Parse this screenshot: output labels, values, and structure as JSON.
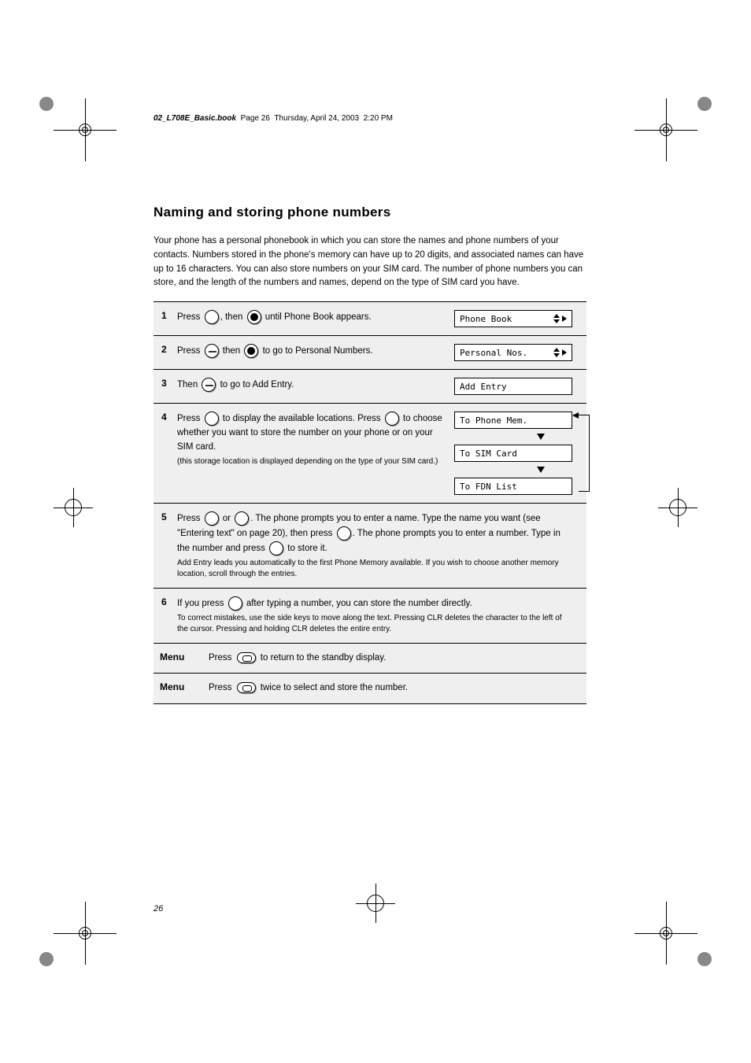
{
  "running_header": {
    "file": "02_L708E_Basic.book",
    "page_label": "Page 26",
    "date": "Thursday, April 24, 2003",
    "time": "2:20 PM"
  },
  "page_number": "26",
  "title": "Naming and storing phone numbers",
  "intro": "Your phone has a personal phonebook in which you can store the names and phone numbers of your contacts. Numbers stored in the phone's memory can have up to 20 digits, and associated names can have up to 16 characters. You can also store numbers on your SIM card. The number of phone numbers you can store, and the length of the numbers and names, depend on the type of SIM card you have.",
  "steps": {
    "s1": {
      "text": "Press ",
      "text2": ", then ",
      "text3": " until Phone Book appears.",
      "lcd": "Phone Book"
    },
    "s2": {
      "text": "Press ",
      "text2": " then ",
      "text3": " to go to Personal Numbers.",
      "lcd": "Personal Nos."
    },
    "s3": {
      "text": "Then ",
      "text2": " to go to Add Entry.",
      "lcd": "Add Entry"
    },
    "s4": {
      "text": "Press ",
      "text2": " to display the available locations. Press ",
      "text3": " to choose whether you want to store the number on your phone or on your SIM card.",
      "lcd_a": "To Phone Mem.",
      "lcd_b": "To SIM Card",
      "lcd_c": "To FDN List",
      "note_a": "(this storage location is displayed depending on the type of your SIM card.)"
    },
    "s5": {
      "text": "Press ",
      "text2": " or ",
      "text3": ". The phone prompts you to enter a name. Type the name you want (see \"Entering text\" on page 20), then press ",
      "text4": ". The phone prompts you to enter a number. Type in the number and press ",
      "text5": " to store it.",
      "note": "Add Entry leads you automatically to the first Phone Memory available. If you wish to choose another memory location, scroll through the entries."
    },
    "s6": {
      "text": "If you press ",
      "text2": " after typing a number, you can store the number directly.",
      "note": "To correct mistakes, use the side keys to move along the text. Pressing CLR deletes the character to the left of the cursor. Pressing and holding CLR deletes the entire entry."
    },
    "s7": {
      "text_prefix": "Press ",
      "text": " to return to the standby display."
    },
    "s8": {
      "text_prefix": "Press ",
      "text": " twice to select and store the number."
    },
    "menu_heading": "Menu"
  }
}
